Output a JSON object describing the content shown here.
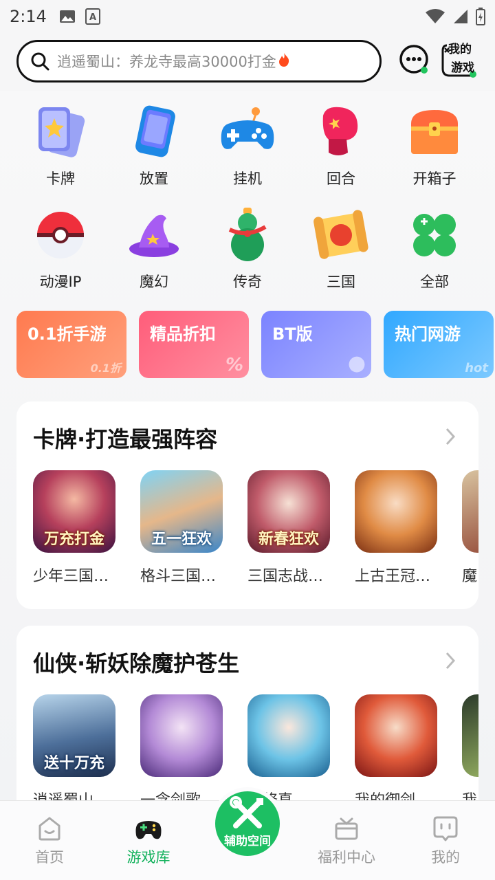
{
  "status_bar": {
    "time": "2:14"
  },
  "search": {
    "placeholder": "逍遥蜀山：养龙寺最高30000打金"
  },
  "header": {
    "my_games_line1": "我的",
    "my_games_line2": "游戏"
  },
  "categories": [
    {
      "label": "卡牌",
      "icon": "cards-icon"
    },
    {
      "label": "放置",
      "icon": "phone-icon"
    },
    {
      "label": "挂机",
      "icon": "gamepad-icon"
    },
    {
      "label": "回合",
      "icon": "boxing-glove-icon"
    },
    {
      "label": "开箱子",
      "icon": "treasure-chest-icon"
    },
    {
      "label": "动漫IP",
      "icon": "pokeball-icon"
    },
    {
      "label": "魔幻",
      "icon": "wizard-hat-icon"
    },
    {
      "label": "传奇",
      "icon": "gourd-icon"
    },
    {
      "label": "三国",
      "icon": "war-scroll-icon"
    },
    {
      "label": "全部",
      "icon": "clover-icon"
    }
  ],
  "promos": [
    {
      "label": "0.1折手游",
      "deco": "0.1折",
      "color_from": "#ff7a4f",
      "color_to": "#ffa07c"
    },
    {
      "label": "精品折扣",
      "deco": "%",
      "color_from": "#ff5d7a",
      "color_to": "#ff8fa0"
    },
    {
      "label": "BT版",
      "deco": "●",
      "color_from": "#7b83ff",
      "color_to": "#a9b0ff"
    },
    {
      "label": "热门网游",
      "deco": "hot",
      "color_from": "#31a8ff",
      "color_to": "#7cc9ff"
    }
  ],
  "sections": [
    {
      "title": "卡牌·打造最强阵容",
      "games": [
        {
          "name": "少年三国…",
          "banner": "万充打金"
        },
        {
          "name": "格斗三国…",
          "banner": "五一狂欢"
        },
        {
          "name": "三国志战…",
          "banner": "新春狂欢"
        },
        {
          "name": "上古王冠…",
          "banner": ""
        },
        {
          "name": "魔",
          "banner": ""
        }
      ]
    },
    {
      "title": "仙侠·斩妖除魔护苍生",
      "games": [
        {
          "name": "逍遥蜀山",
          "banner": "送十万充"
        },
        {
          "name": "一念剑歌",
          "banner": ""
        },
        {
          "name": "太修真",
          "banner": ""
        },
        {
          "name": "我的御剑",
          "banner": ""
        },
        {
          "name": "我",
          "banner": ""
        }
      ]
    }
  ],
  "bottom_nav": {
    "home": "首页",
    "library": "游戏库",
    "assistant": "辅助空间",
    "welfare": "福利中心",
    "mine": "我的"
  },
  "colors": {
    "accent": "#1dbf63",
    "active_tab": "#11b15b"
  }
}
